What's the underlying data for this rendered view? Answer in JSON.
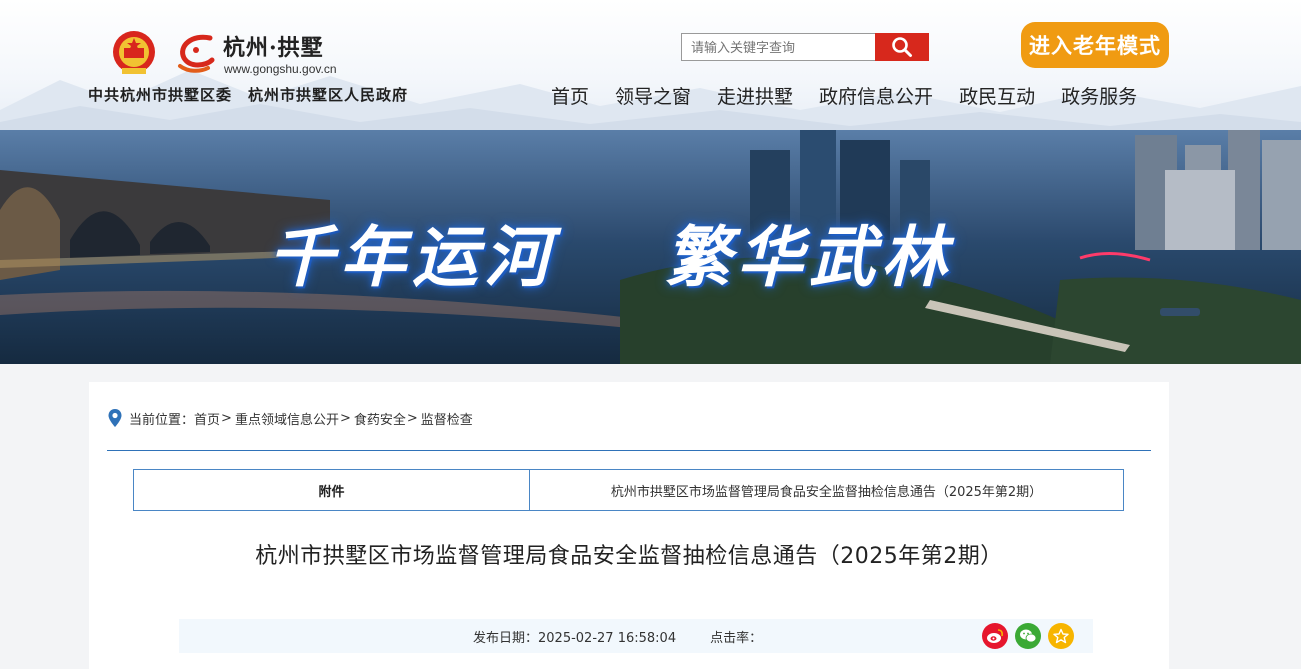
{
  "header": {
    "site_name": "杭州·拱墅",
    "site_url": "www.gongshu.gov.cn",
    "org_party": "中共杭州市拱墅区委",
    "org_government": "杭州市拱墅区人民政府",
    "search_placeholder": "请输入关键字查询",
    "elder_mode_label": "进入老年模式",
    "nav": [
      {
        "label": "首页"
      },
      {
        "label": "领导之窗"
      },
      {
        "label": "走进拱墅"
      },
      {
        "label": "政府信息公开"
      },
      {
        "label": "政民互动"
      },
      {
        "label": "政务服务"
      }
    ]
  },
  "banner": {
    "slogan_1": "千年运河",
    "slogan_2": "繁华武林"
  },
  "breadcrumb": {
    "prefix": "当前位置：",
    "items": [
      "首页",
      "重点领域信息公开",
      "食药安全",
      "监督检查"
    ],
    "separator": ">"
  },
  "attachment": {
    "label": "附件",
    "file_name": "杭州市拱墅区市场监督管理局食品安全监督抽检信息通告（2025年第2期）"
  },
  "article": {
    "title": "杭州市拱墅区市场监督管理局食品安全监督抽检信息通告（2025年第2期）",
    "publish_label": "发布日期：",
    "publish_date": "2025-02-27 16:58:04",
    "hits_label": "点击率：",
    "hits_value": ""
  },
  "share": {
    "icons": [
      "weibo-icon",
      "wechat-icon",
      "favorite-icon"
    ]
  },
  "colors": {
    "accent_red": "#d7281c",
    "elder_orange": "#f09b12",
    "link_blue": "#2f72b8"
  }
}
